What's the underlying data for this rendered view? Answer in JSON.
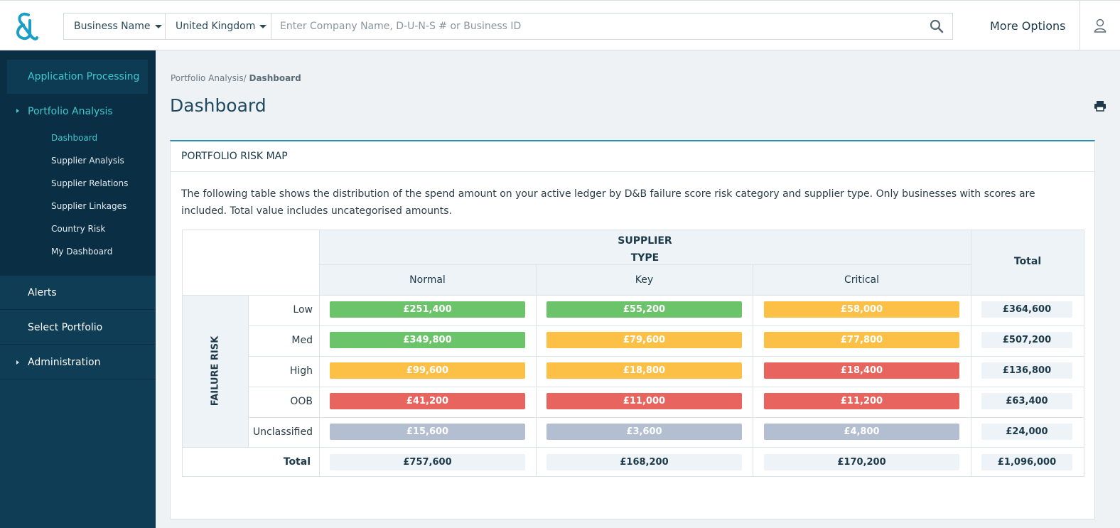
{
  "header": {
    "search_type": "Business Name",
    "country": "United Kingdom",
    "search_placeholder": "Enter Company Name, D-U-N-S # or Business ID",
    "more_options": "More Options"
  },
  "sidebar": {
    "application_processing": "Application Processing",
    "portfolio_analysis": "Portfolio Analysis",
    "sub_items": [
      "Dashboard",
      "Supplier Analysis",
      "Supplier Relations",
      "Supplier Linkages",
      "Country Risk",
      "My Dashboard"
    ],
    "alerts": "Alerts",
    "select_portfolio": "Select Portfolio",
    "administration": "Administration"
  },
  "breadcrumb": {
    "parent": "Portfolio Analysis",
    "separator": "/",
    "current": "Dashboard"
  },
  "page_title": "Dashboard",
  "card": {
    "title": "PORTFOLIO RISK MAP",
    "description": "The following table shows the distribution of the spend amount on your active ledger by D&B failure score risk category and supplier type. Only businesses with scores are included. Total value includes uncategorised amounts."
  },
  "risk_table": {
    "supplier_type_line1": "SUPPLIER",
    "supplier_type_line2": "TYPE",
    "failure_risk_label": "FAILURE RISK",
    "total_label": "Total",
    "columns": [
      "Normal",
      "Key",
      "Critical"
    ],
    "rows": [
      {
        "label": "Low",
        "values": [
          "£251,400",
          "£55,200",
          "£58,000"
        ],
        "status": [
          "green",
          "green",
          "amber"
        ],
        "total": "£364,600"
      },
      {
        "label": "Med",
        "values": [
          "£349,800",
          "£79,600",
          "£77,800"
        ],
        "status": [
          "green",
          "amber",
          "amber"
        ],
        "total": "£507,200"
      },
      {
        "label": "High",
        "values": [
          "£99,600",
          "£18,800",
          "£18,400"
        ],
        "status": [
          "amber",
          "amber",
          "red"
        ],
        "total": "£136,800"
      },
      {
        "label": "OOB",
        "values": [
          "£41,200",
          "£11,000",
          "£11,200"
        ],
        "status": [
          "red",
          "red",
          "red"
        ],
        "total": "£63,400"
      },
      {
        "label": "Unclassified",
        "values": [
          "£15,600",
          "£3,600",
          "£4,800"
        ],
        "status": [
          "grey",
          "grey",
          "grey"
        ],
        "total": "£24,000"
      }
    ],
    "column_totals": [
      "£757,600",
      "£168,200",
      "£170,200"
    ],
    "grand_total": "£1,096,000"
  },
  "colors": {
    "green": "#6cc46a",
    "amber": "#fcc046",
    "red": "#e8645f",
    "grey": "#b3bfd0",
    "sidebar": "#0f3d56",
    "accent": "#3ec8cf"
  },
  "icons": [
    "db-logo-icon",
    "chevron-down-icon",
    "search-icon",
    "user-icon",
    "print-icon"
  ]
}
